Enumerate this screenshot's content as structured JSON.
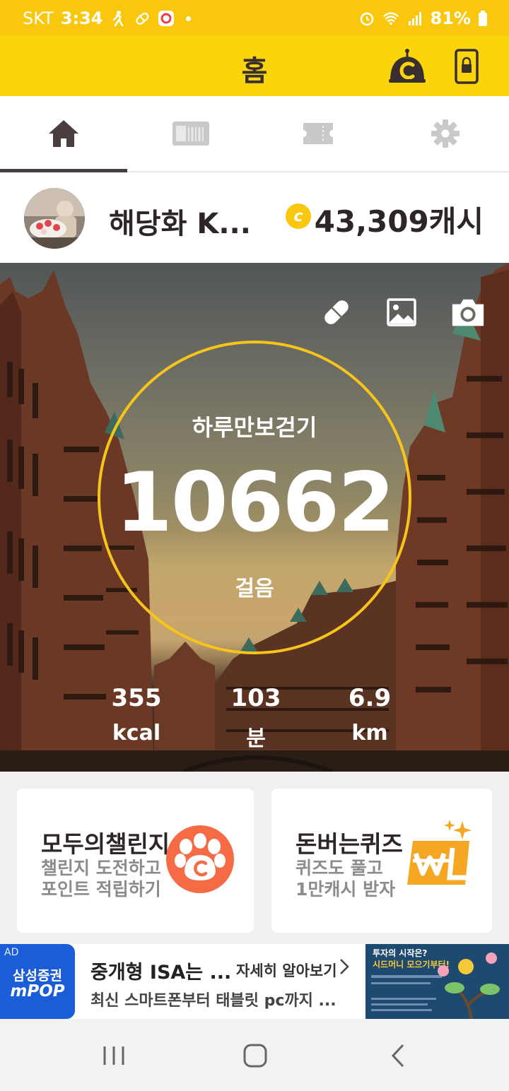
{
  "status_bar": {
    "carrier": "SKT",
    "time": "3:34",
    "battery": "81%"
  },
  "header": {
    "title": "홈"
  },
  "tabs": [
    {
      "name": "home",
      "active": true
    },
    {
      "name": "gift",
      "active": false
    },
    {
      "name": "ticket",
      "active": false
    },
    {
      "name": "settings",
      "active": false
    }
  ],
  "profile": {
    "name": "해당화 K...",
    "coin_symbol": "c",
    "cash": "43,309캐시"
  },
  "pedometer": {
    "label": "하루만보걷기",
    "steps": "10662",
    "unit": "걸음",
    "progress": 1.0,
    "stats": [
      {
        "value": "355",
        "unit": "kcal"
      },
      {
        "value": "103",
        "unit": "분"
      },
      {
        "value": "6.9",
        "unit": "km"
      }
    ]
  },
  "cards": {
    "challenge": {
      "title": "모두의챌린지",
      "line1": "챌린지 도전하고",
      "line2": "포인트 적립하기"
    },
    "quiz": {
      "title": "돈버는퀴즈",
      "line1": "퀴즈도 풀고",
      "line2": "1만캐시 받자"
    }
  },
  "ad": {
    "tag": "AD",
    "brand_line1": "삼성증권",
    "brand_line2": "mPOP",
    "title": "중개형 ISA는 ...",
    "more": "자세히 알아보기",
    "description": "최신 스마트폰부터 태블릿 pc까지 ...",
    "banner_line1": "투자의 시작은?",
    "banner_line2": "시드머니 모으기부터!"
  },
  "colors": {
    "brand_yellow": "#fbd50c",
    "ring": "#f6c41a",
    "challenge_orange": "#f46b45",
    "quiz_orange": "#f5a623"
  }
}
